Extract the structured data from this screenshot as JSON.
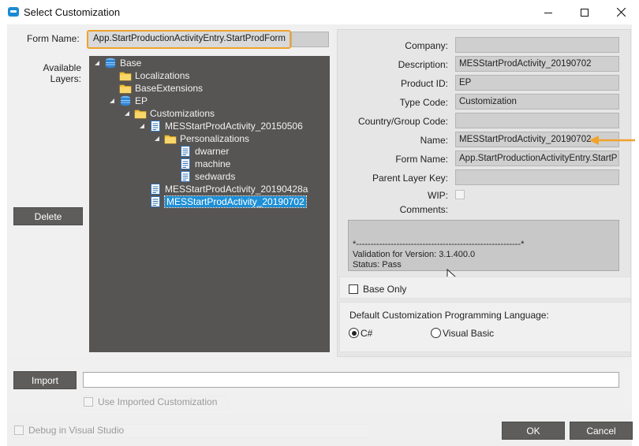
{
  "window": {
    "title": "Select Customization",
    "controls": [
      "minimize-icon",
      "maximize-icon",
      "close-icon"
    ]
  },
  "form_name": {
    "label": "Form Name:",
    "value": "App.StartProductionActivityEntry.StartProdForm"
  },
  "layers": {
    "label": "Available Layers:",
    "tree": [
      {
        "label": "Base",
        "icon": "database-icon",
        "level": 0,
        "expanded": true
      },
      {
        "label": "Localizations",
        "icon": "folder-icon",
        "level": 1
      },
      {
        "label": "BaseExtensions",
        "icon": "folder-icon",
        "level": 1
      },
      {
        "label": "EP",
        "icon": "database-icon",
        "level": 1,
        "expanded": true
      },
      {
        "label": "Customizations",
        "icon": "folder-icon",
        "level": 2,
        "expanded": true
      },
      {
        "label": "MESStartProdActivity_20150506",
        "icon": "document-icon",
        "level": 3,
        "expanded": true
      },
      {
        "label": "Personalizations",
        "icon": "folder-icon",
        "level": 4,
        "expanded": true
      },
      {
        "label": "dwarner",
        "icon": "document-icon",
        "level": 5
      },
      {
        "label": "machine",
        "icon": "document-icon",
        "level": 5
      },
      {
        "label": "sedwards",
        "icon": "document-icon",
        "level": 5
      },
      {
        "label": "MESStartProdActivity_20190428a",
        "icon": "document-icon",
        "level": 3
      },
      {
        "label": "MESStartProdActivity_20190702",
        "icon": "document-icon",
        "level": 3,
        "selected": true
      }
    ]
  },
  "buttons": {
    "delete": "Delete",
    "import": "Import",
    "ok": "OK",
    "cancel": "Cancel"
  },
  "details": {
    "company": {
      "label": "Company:",
      "value": ""
    },
    "description": {
      "label": "Description:",
      "value": "MESStartProdActivity_20190702"
    },
    "product_id": {
      "label": "Product ID:",
      "value": "EP"
    },
    "type_code": {
      "label": "Type Code:",
      "value": "Customization"
    },
    "country_group_code": {
      "label": "Country/Group Code:",
      "value": ""
    },
    "name": {
      "label": "Name:",
      "value": "MESStartProdActivity_20190702"
    },
    "form_name": {
      "label": "Form Name:",
      "value": "App.StartProductionActivityEntry.StartP"
    },
    "parent_layer_key": {
      "label": "Parent Layer Key:",
      "value": ""
    },
    "wip": {
      "label": "WIP:",
      "checked": false
    },
    "comments": {
      "label": "Comments:",
      "lines": [
        "*---------------------------------------------------------*",
        "Validation for Version: 3.1.400.0",
        "Status: Pass"
      ]
    }
  },
  "base_only": {
    "label": "Base Only",
    "checked": false
  },
  "language": {
    "label": "Default Customization Programming Language:",
    "options": [
      {
        "label": "C#",
        "selected": true
      },
      {
        "label": "Visual Basic",
        "selected": false
      }
    ]
  },
  "use_imported": {
    "label": "Use Imported Customization",
    "checked": false,
    "enabled": false
  },
  "import_path": "",
  "debug": {
    "label": "Debug in Visual Studio",
    "checked": false,
    "enabled": false
  },
  "colors": {
    "highlight": "#f0a22d",
    "tree_background": "#575553",
    "selection": "#1e8fd6",
    "dark_button": "#5f5d5b"
  }
}
